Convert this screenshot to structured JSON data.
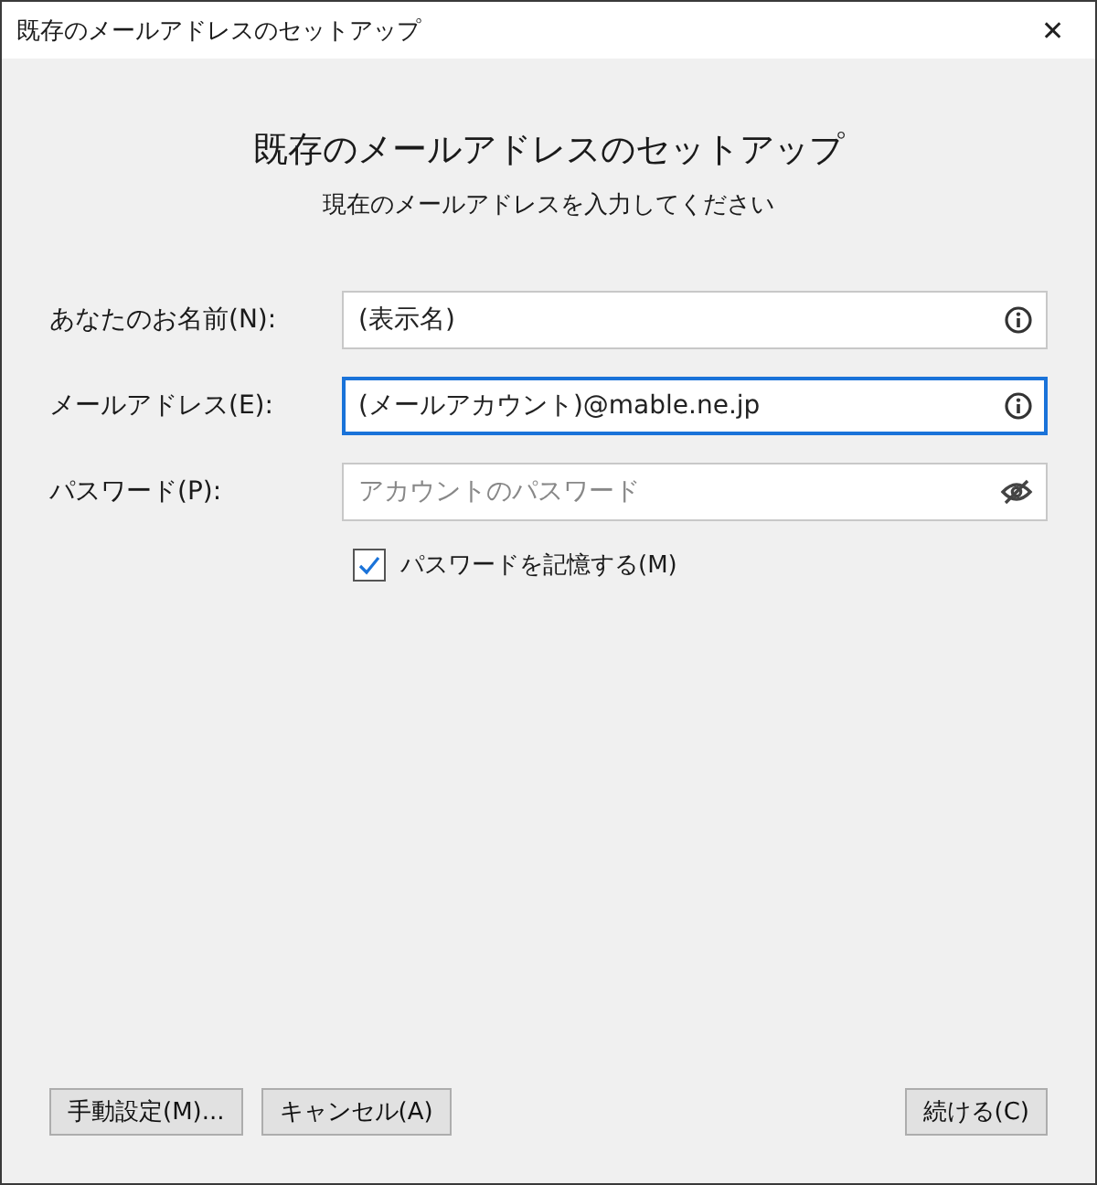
{
  "window": {
    "title": "既存のメールアドレスのセットアップ",
    "close": "✕"
  },
  "heading": "既存のメールアドレスのセットアップ",
  "subheading": "現在のメールアドレスを入力してください",
  "fields": [
    {
      "label": "あなたのお名前(N):",
      "value": "(表示名)",
      "focused": false,
      "kind": "text"
    },
    {
      "label": "メールアドレス(E):",
      "value": "(メールアカウント)@mable.ne.jp",
      "focused": true,
      "kind": "text"
    },
    {
      "label": "パスワード(P):",
      "placeholder": "アカウントのパスワード",
      "focused": false,
      "kind": "password"
    }
  ],
  "remember": {
    "label": "パスワードを記憶する(M)",
    "checked": true
  },
  "buttons": [
    {
      "label": "手動設定(M)..."
    },
    {
      "label": "キャンセル(A)"
    },
    {
      "label": "続ける(C)"
    }
  ]
}
